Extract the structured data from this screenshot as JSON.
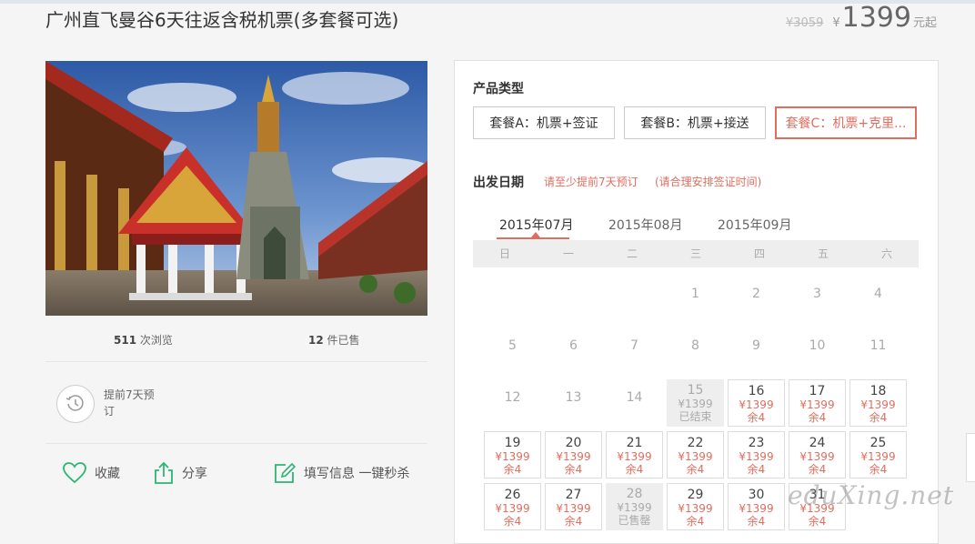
{
  "product": {
    "title": "广州直飞曼谷6天往返含税机票(多套餐可选)",
    "old_price": "¥3059",
    "currency": "¥",
    "price": "1399",
    "price_unit": "元起"
  },
  "stats": {
    "views_count": "511",
    "views_label": "次浏览",
    "sold_count": "12",
    "sold_label": "件已售"
  },
  "advance_booking": "提前7天预订",
  "actions": {
    "favorite": "收藏",
    "share": "分享",
    "fill_info": "填写信息 一键秒杀"
  },
  "panel": {
    "product_type_label": "产品类型",
    "packages": [
      {
        "label": "套餐A：机票+签证",
        "active": false
      },
      {
        "label": "套餐B：机票+接送",
        "active": false
      },
      {
        "label": "套餐C：机票+克里...",
        "active": true
      }
    ],
    "departure_label": "出发日期",
    "note1": "请至少提前7天预订",
    "note2": "(请合理安排签证时间)",
    "months": [
      "2015年07月",
      "2015年08月",
      "2015年09月"
    ],
    "active_month": "2015年07月",
    "weekdays": [
      "日",
      "一",
      "二",
      "三",
      "四",
      "五",
      "六"
    ],
    "calendar": [
      {
        "day": "1",
        "col": 3,
        "row": 0,
        "state": "empty"
      },
      {
        "day": "2",
        "col": 4,
        "row": 0,
        "state": "empty"
      },
      {
        "day": "3",
        "col": 5,
        "row": 0,
        "state": "empty"
      },
      {
        "day": "4",
        "col": 6,
        "row": 0,
        "state": "empty"
      },
      {
        "day": "5",
        "col": 0,
        "row": 1,
        "state": "empty"
      },
      {
        "day": "6",
        "col": 1,
        "row": 1,
        "state": "empty"
      },
      {
        "day": "7",
        "col": 2,
        "row": 1,
        "state": "empty"
      },
      {
        "day": "8",
        "col": 3,
        "row": 1,
        "state": "empty"
      },
      {
        "day": "9",
        "col": 4,
        "row": 1,
        "state": "empty"
      },
      {
        "day": "10",
        "col": 5,
        "row": 1,
        "state": "empty"
      },
      {
        "day": "11",
        "col": 6,
        "row": 1,
        "state": "empty"
      },
      {
        "day": "12",
        "col": 0,
        "row": 2,
        "state": "empty"
      },
      {
        "day": "13",
        "col": 1,
        "row": 2,
        "state": "empty"
      },
      {
        "day": "14",
        "col": 2,
        "row": 2,
        "state": "empty"
      },
      {
        "day": "15",
        "col": 3,
        "row": 2,
        "state": "closed",
        "price": "¥1399",
        "remark": "已结束"
      },
      {
        "day": "16",
        "col": 4,
        "row": 2,
        "state": "avail",
        "price": "¥1399",
        "remark": "余4"
      },
      {
        "day": "17",
        "col": 5,
        "row": 2,
        "state": "avail",
        "price": "¥1399",
        "remark": "余4"
      },
      {
        "day": "18",
        "col": 6,
        "row": 2,
        "state": "avail",
        "price": "¥1399",
        "remark": "余4"
      },
      {
        "day": "19",
        "col": 0,
        "row": 3,
        "state": "avail",
        "price": "¥1399",
        "remark": "余4"
      },
      {
        "day": "20",
        "col": 1,
        "row": 3,
        "state": "avail",
        "price": "¥1399",
        "remark": "余4"
      },
      {
        "day": "21",
        "col": 2,
        "row": 3,
        "state": "avail",
        "price": "¥1399",
        "remark": "余4"
      },
      {
        "day": "22",
        "col": 3,
        "row": 3,
        "state": "avail",
        "price": "¥1399",
        "remark": "余4"
      },
      {
        "day": "23",
        "col": 4,
        "row": 3,
        "state": "avail",
        "price": "¥1399",
        "remark": "余4"
      },
      {
        "day": "24",
        "col": 5,
        "row": 3,
        "state": "avail",
        "price": "¥1399",
        "remark": "余4"
      },
      {
        "day": "25",
        "col": 6,
        "row": 3,
        "state": "avail",
        "price": "¥1399",
        "remark": "余4"
      },
      {
        "day": "26",
        "col": 0,
        "row": 4,
        "state": "avail",
        "price": "¥1399",
        "remark": "余4"
      },
      {
        "day": "27",
        "col": 1,
        "row": 4,
        "state": "avail",
        "price": "¥1399",
        "remark": "余4"
      },
      {
        "day": "28",
        "col": 2,
        "row": 4,
        "state": "closed",
        "price": "¥1399",
        "remark": "已售罄"
      },
      {
        "day": "29",
        "col": 3,
        "row": 4,
        "state": "avail",
        "price": "¥1399",
        "remark": "余4"
      },
      {
        "day": "30",
        "col": 4,
        "row": 4,
        "state": "avail",
        "price": "¥1399",
        "remark": "余4"
      },
      {
        "day": "31",
        "col": 5,
        "row": 4,
        "state": "avail",
        "price": "¥1399",
        "remark": "余4"
      }
    ]
  },
  "watermark": "eduXing.net",
  "colors": {
    "accent": "#e06e5e",
    "icon_green": "#2bb673"
  }
}
